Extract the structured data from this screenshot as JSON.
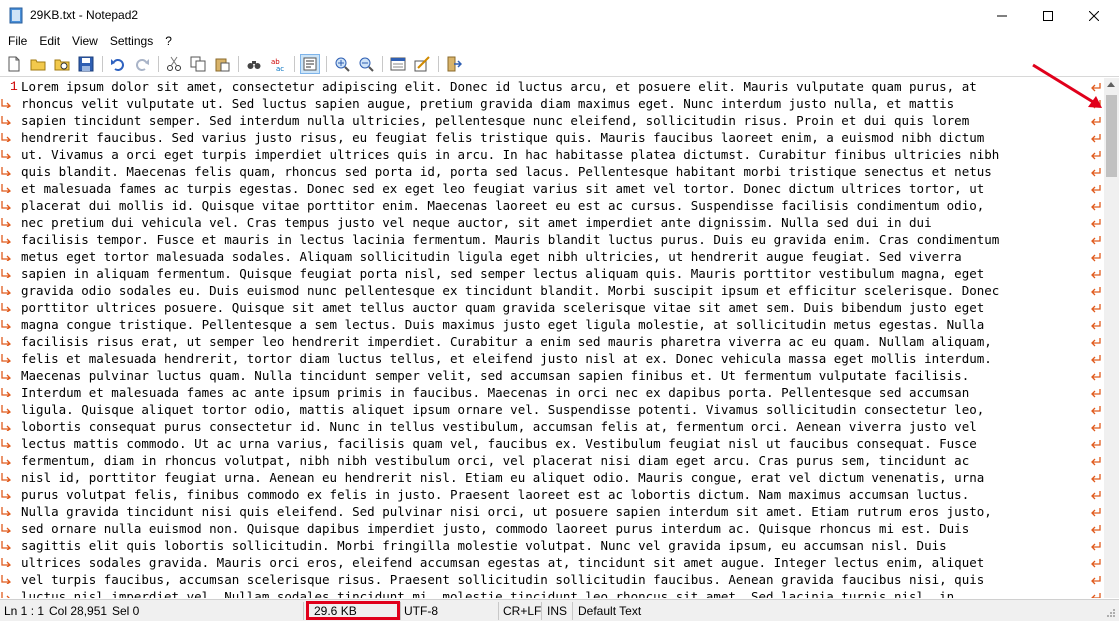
{
  "window": {
    "title": "29KB.txt - Notepad2",
    "minimize_icon": "minimize-icon",
    "maximize_icon": "maximize-icon",
    "close_icon": "close-icon"
  },
  "menu": [
    "File",
    "Edit",
    "View",
    "Settings",
    "?"
  ],
  "toolbar": {
    "buttons": [
      "new-file-icon",
      "open-folder-icon",
      "browse-icon",
      "save-icon",
      "undo-icon",
      "redo-icon",
      "cut-icon",
      "copy-icon",
      "paste-icon",
      "find-icon",
      "replace-icon",
      "word-wrap-icon",
      "zoom-in-icon",
      "zoom-out-icon",
      "select-scheme-icon",
      "customize-scheme-icon",
      "exit-icon"
    ],
    "active": "word-wrap-icon"
  },
  "editor": {
    "line_number": "1",
    "lines": [
      "Lorem ipsum dolor sit amet, consectetur adipiscing elit. Donec id luctus arcu, et posuere elit. Mauris vulputate quam purus, at",
      "rhoncus velit vulputate ut. Sed luctus sapien augue, pretium gravida diam maximus eget. Nunc interdum justo nulla, et mattis",
      "sapien tincidunt semper. Sed interdum nulla ultricies, pellentesque nunc eleifend, sollicitudin risus. Proin et dui quis lorem",
      "hendrerit faucibus. Sed varius justo risus, eu feugiat felis tristique quis. Mauris faucibus laoreet enim, a euismod nibh dictum",
      "ut. Vivamus a orci eget turpis imperdiet ultrices quis in arcu. In hac habitasse platea dictumst. Curabitur finibus ultricies nibh",
      "quis blandit. Maecenas felis quam, rhoncus sed porta id, porta sed lacus. Pellentesque habitant morbi tristique senectus et netus",
      "et malesuada fames ac turpis egestas. Donec sed ex eget leo feugiat varius sit amet vel tortor. Donec dictum ultrices tortor, ut",
      "placerat dui mollis id. Quisque vitae porttitor enim. Maecenas laoreet eu est ac cursus. Suspendisse facilisis condimentum odio,",
      "nec pretium dui vehicula vel. Cras tempus justo vel neque auctor, sit amet imperdiet ante dignissim. Nulla sed dui in dui",
      "facilisis tempor. Fusce et mauris in lectus lacinia fermentum. Mauris blandit luctus purus. Duis eu gravida enim. Cras condimentum",
      "metus eget tortor malesuada sodales. Aliquam sollicitudin ligula eget nibh ultricies, ut hendrerit augue feugiat. Sed viverra",
      "sapien in aliquam fermentum. Quisque feugiat porta nisl, sed semper lectus aliquam quis. Mauris porttitor vestibulum magna, eget",
      "gravida odio sodales eu. Duis euismod nunc pellentesque ex tincidunt blandit. Morbi suscipit ipsum et efficitur scelerisque. Donec",
      "porttitor ultrices posuere. Quisque sit amet tellus auctor quam gravida scelerisque vitae sit amet sem. Duis bibendum justo eget",
      "magna congue tristique. Pellentesque a sem lectus. Duis maximus justo eget ligula molestie, at sollicitudin metus egestas. Nulla",
      "facilisis risus erat, ut semper leo hendrerit imperdiet. Curabitur a enim sed mauris pharetra viverra ac eu quam. Nullam aliquam,",
      "felis et malesuada hendrerit, tortor diam luctus tellus, et eleifend justo nisl at ex. Donec vehicula massa eget mollis interdum.",
      "Maecenas pulvinar luctus quam. Nulla tincidunt semper velit, sed accumsan sapien finibus et. Ut fermentum vulputate facilisis.",
      "Interdum et malesuada fames ac ante ipsum primis in faucibus. Maecenas in orci nec ex dapibus porta. Pellentesque sed accumsan",
      "ligula. Quisque aliquet tortor odio, mattis aliquet ipsum ornare vel. Suspendisse potenti. Vivamus sollicitudin consectetur leo,",
      "lobortis consequat purus consectetur id. Nunc in tellus vestibulum, accumsan felis at, fermentum orci. Aenean viverra justo vel",
      "lectus mattis commodo. Ut ac urna varius, facilisis quam vel, faucibus ex. Vestibulum feugiat nisl ut faucibus consequat. Fusce",
      "fermentum, diam in rhoncus volutpat, nibh nibh vestibulum orci, vel placerat nisi diam eget arcu. Cras purus sem, tincidunt ac",
      "nisl id, porttitor feugiat urna. Aenean eu hendrerit nisl. Etiam eu aliquet odio. Mauris congue, erat vel dictum venenatis, urna",
      "purus volutpat felis, finibus commodo ex felis in justo. Praesent laoreet est ac lobortis dictum. Nam maximus accumsan luctus.",
      "Nulla gravida tincidunt nisi quis eleifend. Sed pulvinar nisi orci, ut posuere sapien interdum sit amet. Etiam rutrum eros justo,",
      "sed ornare nulla euismod non. Quisque dapibus imperdiet justo, commodo laoreet purus interdum ac. Quisque rhoncus mi est. Duis",
      "sagittis elit quis lobortis sollicitudin. Morbi fringilla molestie volutpat. Nunc vel gravida ipsum, eu accumsan nisl. Duis",
      "ultrices sodales gravida. Mauris orci eros, eleifend accumsan egestas at, tincidunt sit amet augue. Integer lectus enim, aliquet",
      "vel turpis faucibus, accumsan scelerisque risus. Praesent sollicitudin sollicitudin faucibus. Aenean gravida faucibus nisi, quis",
      "luctus nisl imperdiet vel. Nullam sodales tincidunt mi, molestie tincidunt leo rhoncus sit amet. Sed lacinia turpis nisl, in"
    ]
  },
  "statusbar": {
    "position": "Ln 1 : 1",
    "column": "Col 28,951",
    "selection": "Sel 0",
    "size": "29.6 KB",
    "encoding": "UTF-8",
    "line_endings": "CR+LF",
    "insert_mode": "INS",
    "scheme": "Default Text"
  },
  "colors": {
    "annotation": "#e0001b",
    "wrap_marker": "#e05a1c",
    "line_number": "#c00000"
  }
}
